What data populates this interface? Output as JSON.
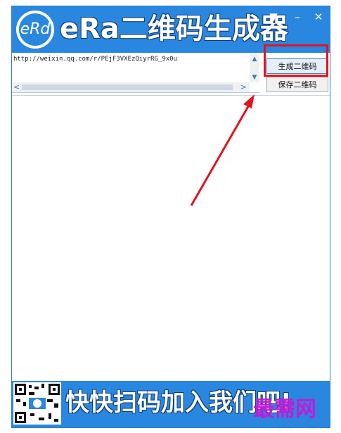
{
  "window": {
    "logo_text": "eRd",
    "title": "eRa二维码生成器",
    "controls": {
      "menu": "▼",
      "minimize": "–",
      "close": "✕"
    }
  },
  "input": {
    "url": "http://weixin.qq.com/r/PEjF3VXEzQiyrRG_9x0u",
    "scroll_up": "▲",
    "scroll_down": "▼",
    "scroll_left": "<",
    "scroll_right": ">"
  },
  "buttons": {
    "generate": "生成二维码",
    "save": "保存二维码"
  },
  "banner": {
    "text": "快快扫码加入我们吧!"
  },
  "watermark": "最需网",
  "colors": {
    "accent": "#2a87e0",
    "highlight": "#e0141e",
    "watermark": "#c21ad6"
  }
}
